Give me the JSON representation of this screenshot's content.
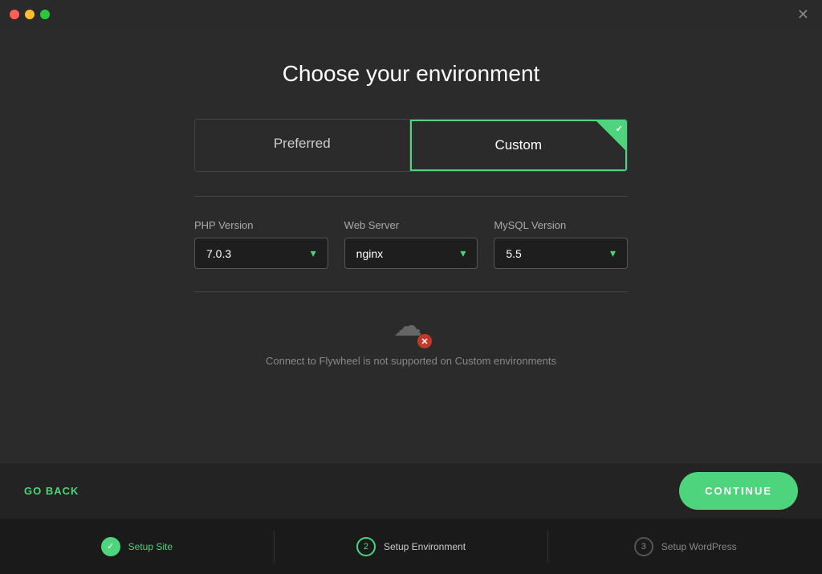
{
  "titlebar": {
    "close_label": "✕"
  },
  "header": {
    "title": "Choose your environment"
  },
  "tabs": {
    "preferred_label": "Preferred",
    "custom_label": "Custom"
  },
  "dropdowns": {
    "php": {
      "label": "PHP Version",
      "value": "7.0.3"
    },
    "webserver": {
      "label": "Web Server",
      "value": "nginx"
    },
    "mysql": {
      "label": "MySQL Version",
      "value": "5.5"
    }
  },
  "notice": {
    "text": "Connect to Flywheel is not supported on Custom environments"
  },
  "footer": {
    "go_back_label": "GO BACK",
    "continue_label": "CONTINUE"
  },
  "steps": [
    {
      "number": "✓",
      "label": "Setup Site",
      "state": "completed"
    },
    {
      "number": "2",
      "label": "Setup Environment",
      "state": "active"
    },
    {
      "number": "3",
      "label": "Setup WordPress",
      "state": "inactive"
    }
  ]
}
